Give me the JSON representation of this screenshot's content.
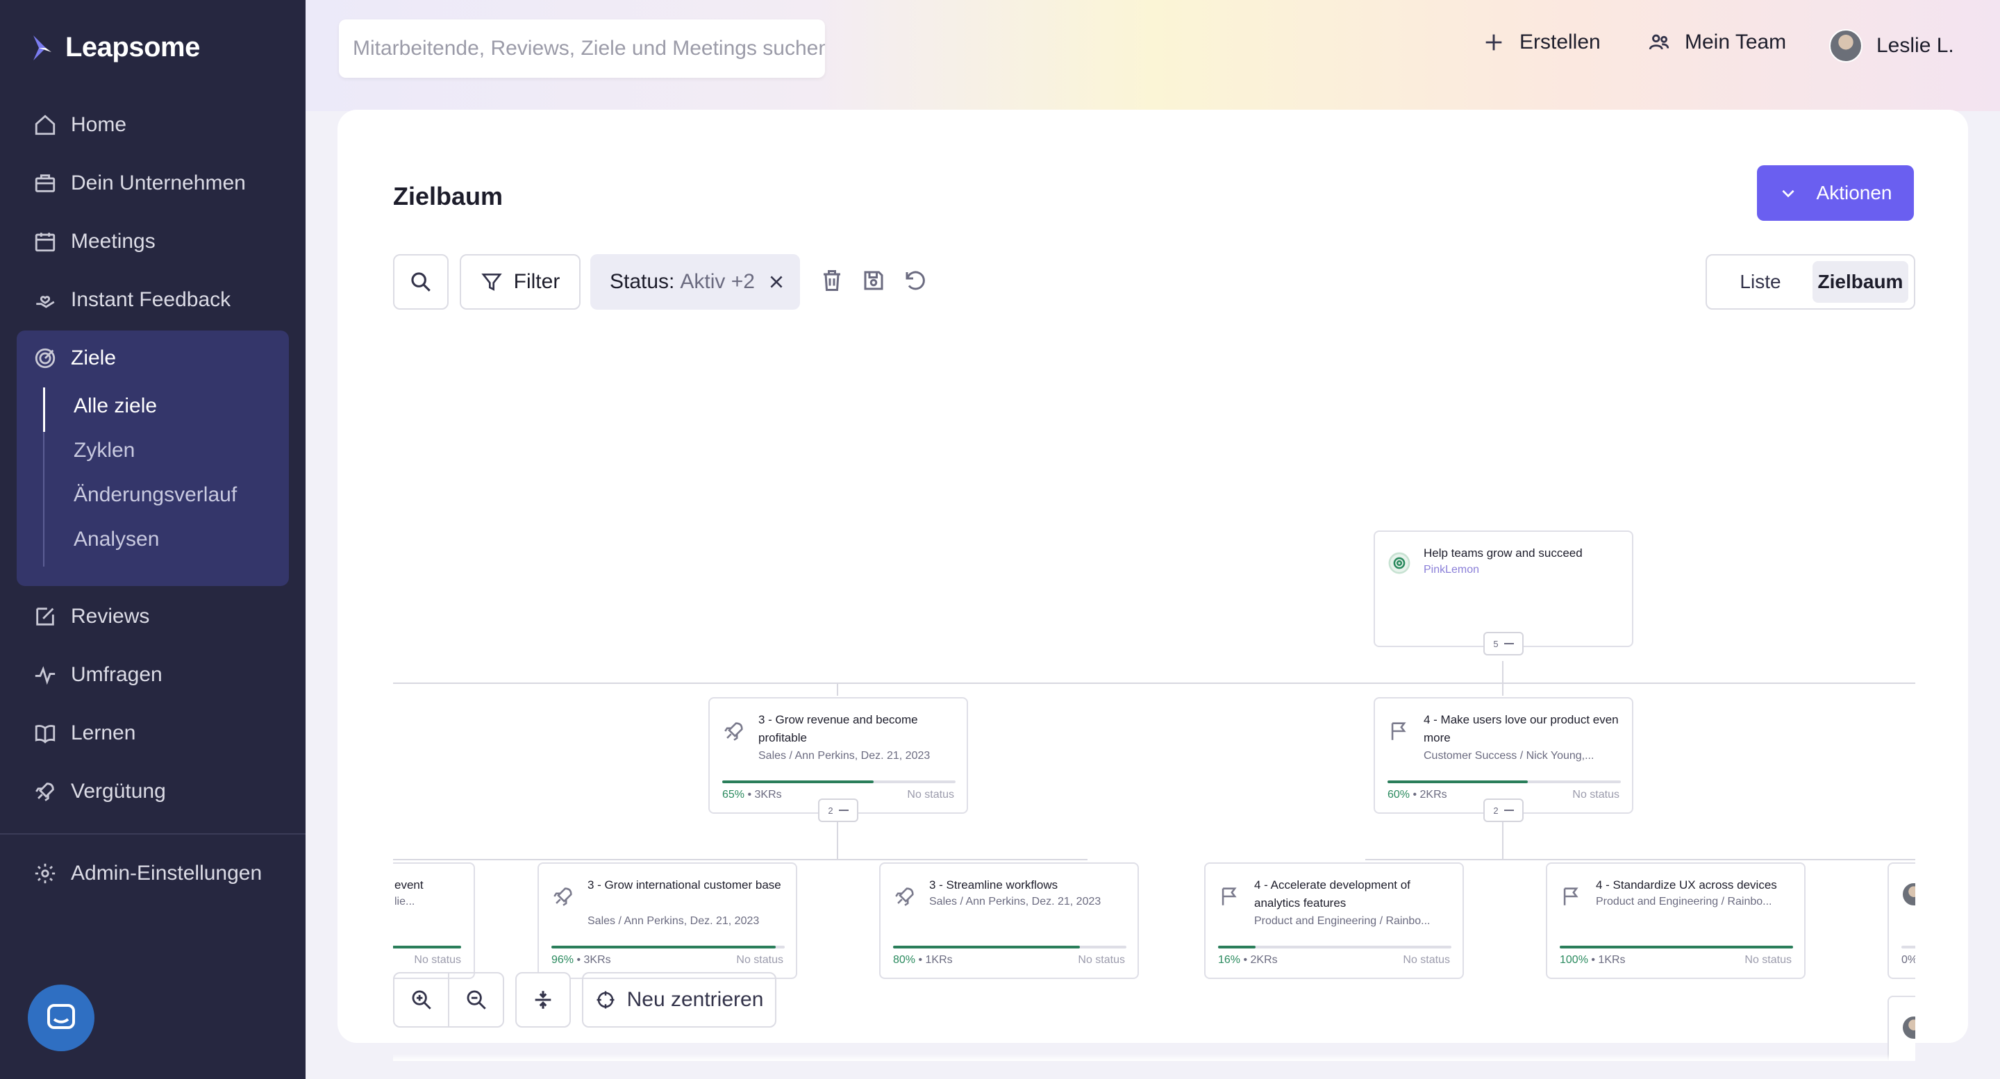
{
  "app": {
    "name": "Leapsome"
  },
  "sidebar": {
    "items": [
      {
        "label": "Home",
        "icon": "home-icon"
      },
      {
        "label": "Dein Unternehmen",
        "icon": "briefcase-icon"
      },
      {
        "label": "Meetings",
        "icon": "calendar-icon"
      },
      {
        "label": "Instant Feedback",
        "icon": "hand-heart-icon"
      },
      {
        "label": "Ziele",
        "icon": "target-icon"
      },
      {
        "label": "Reviews",
        "icon": "edit-icon"
      },
      {
        "label": "Umfragen",
        "icon": "pulse-icon"
      },
      {
        "label": "Lernen",
        "icon": "book-icon"
      },
      {
        "label": "Vergütung",
        "icon": "rocket-icon"
      },
      {
        "label": "Admin-Einstellungen",
        "icon": "gear-icon"
      }
    ],
    "ziele_sub": [
      "Alle ziele",
      "Zyklen",
      "Änderungsverlauf",
      "Analysen"
    ]
  },
  "topbar": {
    "search_placeholder": "Mitarbeitende, Reviews, Ziele und Meetings suchen",
    "create_label": "Erstellen",
    "team_label": "Mein Team",
    "user_name": "Leslie L."
  },
  "page": {
    "title": "Zielbaum",
    "actions_label": "Aktionen",
    "filter_label": "Filter",
    "status_chip": {
      "key": "Status:",
      "value": "Aktiv +2"
    },
    "view_options": [
      "Liste",
      "Zielbaum"
    ],
    "active_view": "Zielbaum",
    "recenter_label": "Neu zentrieren"
  },
  "colors": {
    "accent": "#6a5ff0",
    "sidebar": "#262740",
    "progress": "#2a7e5a"
  },
  "tree": {
    "root": {
      "title": "Help teams grow and succeed",
      "sub": "PinkLemon",
      "children_count": "5"
    },
    "level1": [
      {
        "title": "3 - Grow revenue and become profitable",
        "sub": "Sales / Ann Perkins, Dez. 21, 2023",
        "progress": 0.65,
        "pct": "65%",
        "meta": " • 3KRs",
        "status": "No status",
        "children_count": "2"
      },
      {
        "title": "4 - Make users love our product even more",
        "sub": "Customer Success / Nick Young,...",
        "progress": 0.6,
        "pct": "60%",
        "meta": " • 2KRs",
        "status": "No status",
        "children_count": "2"
      }
    ],
    "level2": [
      {
        "title": "event",
        "sub": "lie...",
        "progress": 1.0,
        "pct": "",
        "meta": "",
        "status": "No status"
      },
      {
        "title": "3 - Grow international customer base",
        "sub": "Sales / Ann Perkins, Dez. 21, 2023",
        "progress": 0.96,
        "pct": "96%",
        "meta": " • 3KRs",
        "status": "No status"
      },
      {
        "title": "3 - Streamline workflows",
        "sub": "Sales / Ann Perkins, Dez. 21, 2023",
        "progress": 0.8,
        "pct": "80%",
        "meta": " • 1KRs",
        "status": "No status"
      },
      {
        "title": "4 - Accelerate development of analytics features",
        "sub": "Product and Engineering / Rainbo...",
        "progress": 0.16,
        "pct": "16%",
        "meta": " • 2KRs",
        "status": "No status"
      },
      {
        "title": "4 - Standardize UX across devices",
        "sub": "Product and Engineering / Rainbo...",
        "progress": 1.0,
        "pct": "100%",
        "meta": " • 1KRs",
        "status": "No status"
      },
      {
        "title": "",
        "sub": "",
        "progress": 0.0,
        "pct": "0%",
        "meta": "",
        "status": ""
      }
    ]
  }
}
